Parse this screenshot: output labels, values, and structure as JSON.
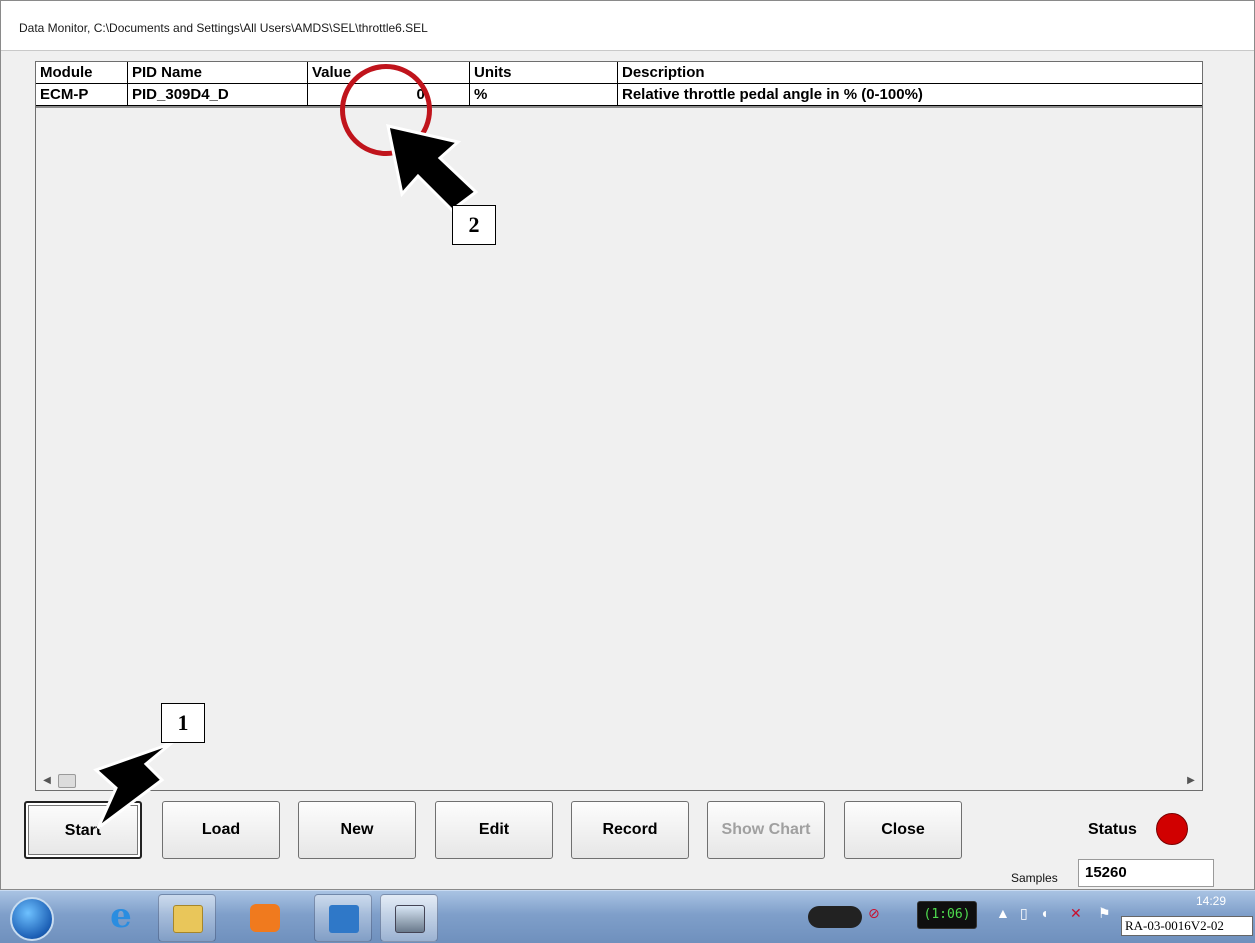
{
  "window": {
    "title": "Data Monitor, C:\\Documents and Settings\\All Users\\AMDS\\SEL\\throttle6.SEL"
  },
  "grid": {
    "columns": [
      "Module",
      "PID Name",
      "Value",
      "Units",
      "Description"
    ],
    "rows": [
      {
        "module": "ECM-P",
        "pid_name": "PID_309D4_D",
        "value": "0.",
        "units": "%",
        "description": "Relative throttle pedal angle in % (0-100%)"
      }
    ]
  },
  "buttons": {
    "start": "Start",
    "load": "Load",
    "new": "New",
    "edit": "Edit",
    "record": "Record",
    "show_chart": "Show Chart",
    "close": "Close"
  },
  "status": {
    "label": "Status",
    "color": "#d10000"
  },
  "samples": {
    "label": "Samples",
    "value": "15260"
  },
  "annotations": {
    "callout_1": "1",
    "callout_2": "2",
    "circle_color": "#c0141c"
  },
  "taskbar": {
    "icons": [
      "windows-start-icon",
      "internet-explorer-icon",
      "file-explorer-icon",
      "media-player-icon",
      "network-app-icon",
      "data-monitor-app-icon"
    ],
    "battery_text": "(1:06)",
    "clock": "14:29"
  },
  "figure_ref": "RA-03-0016V2-02"
}
